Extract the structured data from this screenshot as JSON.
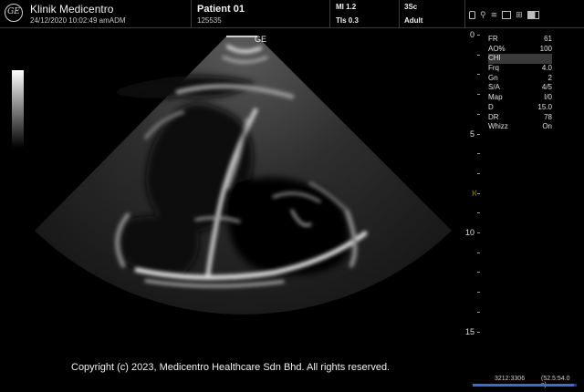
{
  "header": {
    "logo_text": "GE",
    "clinic_name": "Klinik Medicentro",
    "datetime": "24/12/2020 10:02:49 amADM",
    "patient_name": "Patient 01",
    "patient_id": "125535",
    "mi": "MI 1.2",
    "tis": "TIs 0.3",
    "probe": "3Sc",
    "preset": "Adult",
    "status_icons": [
      "lock-icon",
      "usb-icon",
      "wifi-icon",
      "printer-icon",
      "network-icon",
      "battery-icon"
    ]
  },
  "image": {
    "probe_orientation_label": "GE",
    "depth_scale": {
      "unit": "cm",
      "max_depth": 15,
      "labels": [
        "0",
        "5",
        "10",
        "15"
      ],
      "focus_depth": 8
    }
  },
  "params": [
    {
      "key": "FR",
      "value": "61"
    },
    {
      "key": "AO%",
      "value": "100"
    },
    {
      "key": "CHI",
      "value": ""
    },
    {
      "key": "Frq",
      "value": "4.0"
    },
    {
      "key": "Gn",
      "value": "2"
    },
    {
      "key": "S/A",
      "value": "4/5"
    },
    {
      "key": "Map",
      "value": "I/0"
    },
    {
      "key": "D",
      "value": "15.0"
    },
    {
      "key": "DR",
      "value": "78"
    },
    {
      "key": "Whizz",
      "value": "On"
    }
  ],
  "copyright": "Copyright (c) 2023, Medicentro Healthcare Sdn Bhd. All rights reserved.",
  "cine": {
    "frames": "3212:3306",
    "time": "(52.5:54.0 s)",
    "progress": 0.97
  }
}
